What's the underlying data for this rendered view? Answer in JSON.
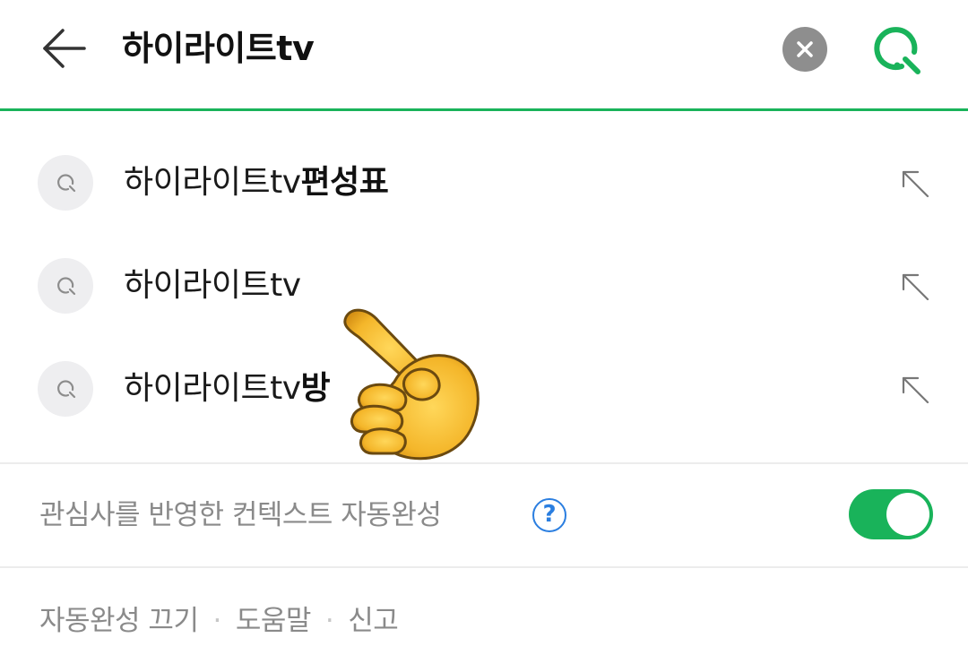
{
  "search": {
    "query": "하이라이트tv"
  },
  "suggestions": [
    {
      "prefix": "하이라이트tv",
      "suffix": "편성표"
    },
    {
      "prefix": "하이라이트tv",
      "suffix": ""
    },
    {
      "prefix": "하이라이트tv",
      "suffix": "방"
    }
  ],
  "context_autocomplete": {
    "label": "관심사를 반영한 컨텍스트 자동완성",
    "help_symbol": "?",
    "enabled": true
  },
  "footer": {
    "autocomplete_off": "자동완성 끄기",
    "help": "도움말",
    "report": "신고",
    "separator": "·"
  },
  "colors": {
    "accent": "#19b35a",
    "help_blue": "#2a7ee0",
    "muted_text": "#8a8a8a"
  },
  "icons": {
    "back": "arrow-left-icon",
    "clear": "clear-x-icon",
    "search": "search-icon",
    "suggestion": "search-small-icon",
    "fill_query": "arrow-up-left-icon",
    "overlay": "pointing-hand-emoji"
  }
}
